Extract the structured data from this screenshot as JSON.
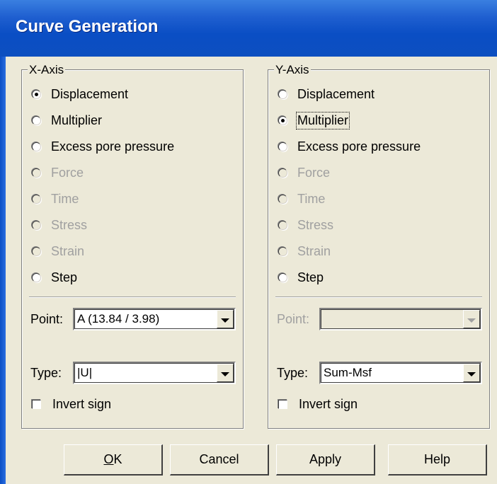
{
  "window": {
    "title": "Curve Generation"
  },
  "x_axis": {
    "label": "X-Axis",
    "options": [
      {
        "label": "Displacement",
        "checked": true,
        "disabled": false
      },
      {
        "label": "Multiplier",
        "checked": false,
        "disabled": false
      },
      {
        "label": "Excess pore pressure",
        "checked": false,
        "disabled": false
      },
      {
        "label": "Force",
        "checked": false,
        "disabled": true
      },
      {
        "label": "Time",
        "checked": false,
        "disabled": true
      },
      {
        "label": "Stress",
        "checked": false,
        "disabled": true
      },
      {
        "label": "Strain",
        "checked": false,
        "disabled": true
      },
      {
        "label": "Step",
        "checked": false,
        "disabled": false
      }
    ],
    "point_label": "Point:",
    "point_value": "A (13.84 / 3.98)",
    "type_label": "Type:",
    "type_value": "|U|",
    "invert_label": "Invert sign",
    "invert_checked": false
  },
  "y_axis": {
    "label": "Y-Axis",
    "options": [
      {
        "label": "Displacement",
        "checked": false,
        "disabled": false
      },
      {
        "label": "Multiplier",
        "checked": true,
        "disabled": false
      },
      {
        "label": "Excess pore pressure",
        "checked": false,
        "disabled": false
      },
      {
        "label": "Force",
        "checked": false,
        "disabled": true
      },
      {
        "label": "Time",
        "checked": false,
        "disabled": true
      },
      {
        "label": "Stress",
        "checked": false,
        "disabled": true
      },
      {
        "label": "Strain",
        "checked": false,
        "disabled": true
      },
      {
        "label": "Step",
        "checked": false,
        "disabled": false
      }
    ],
    "point_label": "Point:",
    "point_value": "",
    "type_label": "Type:",
    "type_value": "Sum-Msf",
    "invert_label": "Invert sign",
    "invert_checked": false
  },
  "buttons": {
    "ok_hotkey": "O",
    "ok_rest": "K",
    "cancel": "Cancel",
    "apply": "Apply",
    "help": "Help"
  }
}
